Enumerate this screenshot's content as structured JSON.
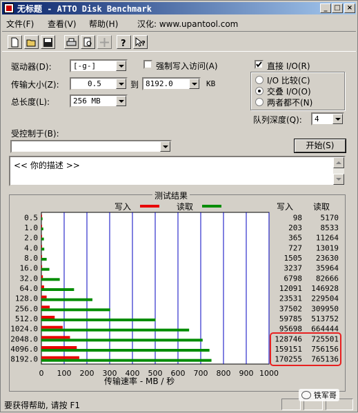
{
  "window": {
    "title": "无标题 - ATTO Disk Benchmark"
  },
  "menu": {
    "file": "文件(F)",
    "view": "查看(V)",
    "help": "帮助(H)",
    "localized": "汉化: www.upantool.com"
  },
  "toolbar": {
    "icons": [
      "new-icon",
      "open-icon",
      "save-icon",
      "print-icon",
      "print-preview-icon",
      "move-icon",
      "help-icon",
      "context-help-icon"
    ]
  },
  "settings": {
    "drive_label": "驱动器(D):",
    "drive_value": "[-g-]",
    "force_write_label": "强制写入访问(A)",
    "force_write_checked": false,
    "transfer_size_label": "传输大小(Z):",
    "transfer_from": "0.5",
    "to_label": "到",
    "transfer_to": "8192.0",
    "transfer_unit": "KB",
    "total_length_label": "总长度(L):",
    "total_length_value": "256 MB",
    "direct_io_label": "直接 I/O(R)",
    "direct_io_checked": true,
    "io_compare_label": "I/O 比较(C)",
    "overlapped_io_label": "交叠 I/O(O)",
    "neither_label": "两者都不(N)",
    "selected_mode": "overlapped",
    "queue_depth_label": "队列深度(Q):",
    "queue_depth_value": "4",
    "controlled_by_label": "受控制于(B):",
    "controlled_by_value": "",
    "start_button": "开始(S)",
    "description": "<< 你的描述 >>"
  },
  "results": {
    "title": "测试结果",
    "legend_write": "写入",
    "legend_read": "读取",
    "col_write": "写入",
    "col_read": "读取",
    "xlabel": "传输速率 - MB / 秒",
    "colors": {
      "write": "#e80000",
      "read": "#008c00",
      "grid": "#0000c0",
      "highlight": "#e82020"
    }
  },
  "chart_data": {
    "type": "bar",
    "title": "测试结果",
    "xlabel": "传输速率 - MB / 秒",
    "ylabel": "",
    "xlim": [
      0,
      1000
    ],
    "x_ticks": [
      0,
      100,
      200,
      300,
      400,
      500,
      600,
      700,
      800,
      900,
      1000
    ],
    "grid": true,
    "legend": "top",
    "categories": [
      "0.5",
      "1.0",
      "2.0",
      "4.0",
      "8.0",
      "16.0",
      "32.0",
      "64.0",
      "128.0",
      "256.0",
      "512.0",
      "1024.0",
      "2048.0",
      "4096.0",
      "8192.0"
    ],
    "series": [
      {
        "name": "写入",
        "values": [
          0.1,
          0.2,
          0.4,
          0.7,
          1.5,
          3.2,
          6.6,
          11.8,
          23.0,
          36.6,
          58.4,
          93.5,
          125.7,
          155.4,
          166.3
        ]
      },
      {
        "name": "读取",
        "values": [
          5.0,
          8.3,
          11.0,
          12.7,
          23.1,
          35.1,
          80.7,
          143.5,
          224.2,
          302.3,
          501.7,
          649.0,
          708.5,
          738.4,
          747.2
        ]
      }
    ],
    "table": {
      "write_kb": [
        98,
        203,
        365,
        727,
        1505,
        3237,
        6798,
        12091,
        23531,
        37502,
        59785,
        95698,
        128746,
        159151,
        170255
      ],
      "read_kb": [
        5170,
        8533,
        11264,
        13019,
        23630,
        35964,
        82666,
        146928,
        229504,
        309950,
        513752,
        664444,
        725501,
        756156,
        765136
      ]
    }
  },
  "status": {
    "text": "要获得帮助, 请按 F1",
    "watermark": "铁军哥"
  }
}
